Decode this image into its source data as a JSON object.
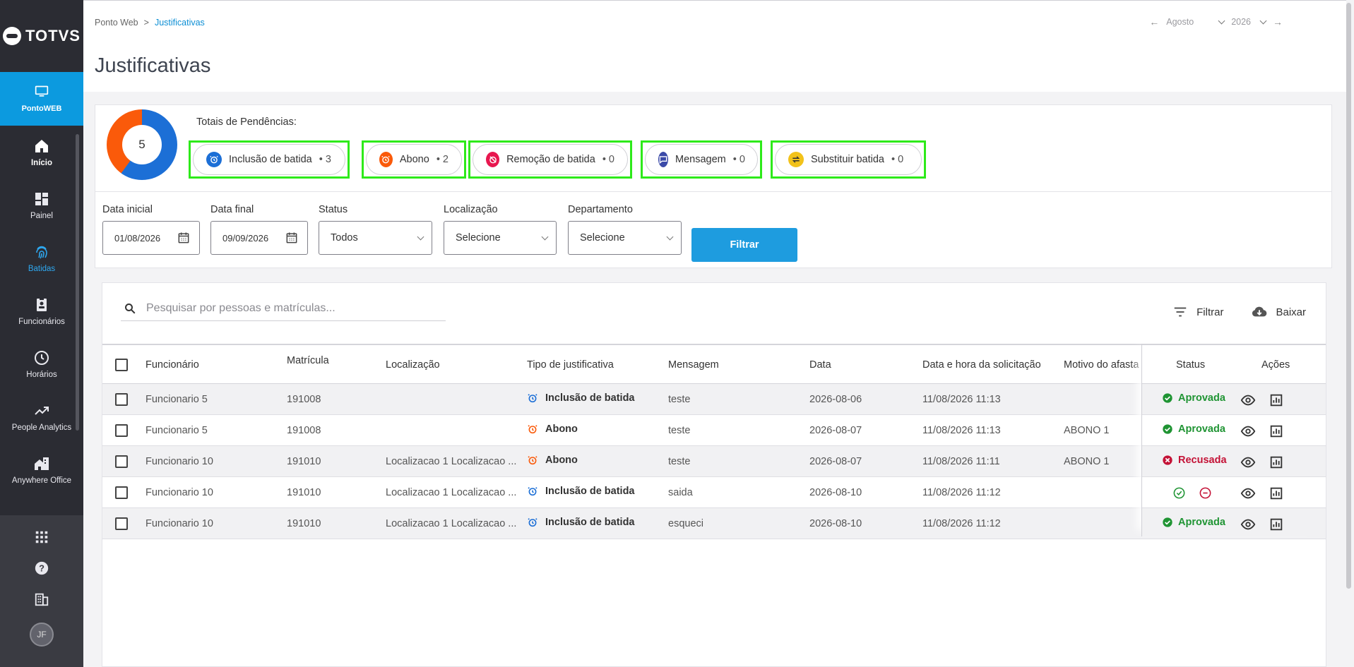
{
  "brand": {
    "name": "TOTVS"
  },
  "sidebar": {
    "app": {
      "label": "PontoWEB"
    },
    "items": [
      {
        "label": "Início",
        "icon": "home-icon"
      },
      {
        "label": "Painel",
        "icon": "dashboard-icon"
      },
      {
        "label": "Batidas",
        "icon": "fingerprint-icon"
      },
      {
        "label": "Funcionários",
        "icon": "badge-icon"
      },
      {
        "label": "Horários",
        "icon": "clock-icon"
      },
      {
        "label": "People Analytics",
        "icon": "trending-icon"
      },
      {
        "label": "Anywhere Office",
        "icon": "home-work-icon"
      }
    ],
    "bottom": {
      "avatar_initials": "JF"
    }
  },
  "header": {
    "breadcrumb": {
      "root": "Ponto Web",
      "separator": ">",
      "current": "Justificativas"
    },
    "title": "Justificativas",
    "period": {
      "month": "Agosto",
      "year": "2026"
    }
  },
  "summary": {
    "total": "5",
    "label": "Totais de Pendências:",
    "chips": [
      {
        "label": "Inclusão de batida",
        "count": "3",
        "color": "#1c6fd6"
      },
      {
        "label": "Abono",
        "count": "2",
        "color": "#fa5a0a"
      },
      {
        "label": "Remoção de batida",
        "count": "0",
        "color": "#e8174f"
      },
      {
        "label": "Mensagem",
        "count": "0",
        "color": "#3b4aa8"
      },
      {
        "label": "Substituir batida",
        "count": "0",
        "color": "#f2c21a"
      }
    ],
    "chart_colors": {
      "inclusao": "#1c6fd6",
      "abono": "#fa5a0a"
    }
  },
  "filters": {
    "start_label": "Data inicial",
    "start_value": "01/08/2026",
    "end_label": "Data final",
    "end_value": "09/09/2026",
    "status_label": "Status",
    "status_value": "Todos",
    "location_label": "Localização",
    "location_value": "Selecione",
    "department_label": "Departamento",
    "department_value": "Selecione",
    "button": "Filtrar"
  },
  "table": {
    "search_placeholder": "Pesquisar por pessoas e matrículas...",
    "filter_label": "Filtrar",
    "download_label": "Baixar",
    "columns": [
      "Funcionário",
      "Matrícula",
      "Localização",
      "Tipo de justificativa",
      "Mensagem",
      "Data",
      "Data e hora da solicitação",
      "Motivo do afasta",
      "Status",
      "Ações"
    ],
    "rows": [
      {
        "employee": "Funcionario 5",
        "id": "191008",
        "location": "",
        "type": "Inclusão de batida",
        "message": "teste",
        "date": "2026-08-06",
        "requested": "11/08/2026 11:13",
        "reason": "",
        "status": "Aprovada"
      },
      {
        "employee": "Funcionario 5",
        "id": "191008",
        "location": "",
        "type": "Abono",
        "message": "teste",
        "date": "2026-08-07",
        "requested": "11/08/2026 11:13",
        "reason": "ABONO 1",
        "status": "Aprovada"
      },
      {
        "employee": "Funcionario 10",
        "id": "191010",
        "location": "Localizacao 1 Localizacao ...",
        "type": "Abono",
        "message": "teste",
        "date": "2026-08-07",
        "requested": "11/08/2026 11:11",
        "reason": "ABONO 1",
        "status": "Recusada"
      },
      {
        "employee": "Funcionario 10",
        "id": "191010",
        "location": "Localizacao 1 Localizacao ...",
        "type": "Inclusão de batida",
        "message": "saida",
        "date": "2026-08-10",
        "requested": "11/08/2026 11:12",
        "reason": "",
        "status": ""
      },
      {
        "employee": "Funcionario 10",
        "id": "191010",
        "location": "Localizacao 1 Localizacao ...",
        "type": "Inclusão de batida",
        "message": "esqueci",
        "date": "2026-08-10",
        "requested": "11/08/2026 11:12",
        "reason": "",
        "status": "Aprovada"
      }
    ]
  }
}
